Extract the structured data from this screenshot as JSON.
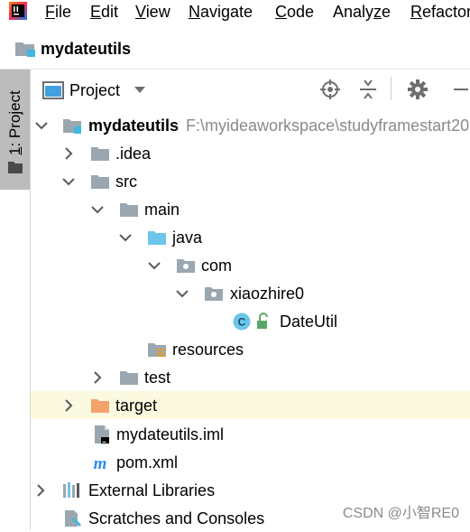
{
  "menu": {
    "items": [
      {
        "mnemonic": "F",
        "rest": "ile"
      },
      {
        "mnemonic": "E",
        "rest": "dit"
      },
      {
        "mnemonic": "V",
        "rest": "iew"
      },
      {
        "mnemonic": "N",
        "rest": "avigate"
      },
      {
        "mnemonic": "C",
        "rest": "ode"
      },
      {
        "pre": "Analy",
        "mnemonic": "z",
        "rest": "e"
      },
      {
        "mnemonic": "R",
        "rest": "efactor"
      }
    ]
  },
  "navbar": {
    "title": "mydateutils"
  },
  "toolwindow": {
    "tab_number": "1",
    "tab_rest": ": Project"
  },
  "panel": {
    "view_label": "Project"
  },
  "tree": {
    "root_name": "mydateutils",
    "root_path": "F:\\myideaworkspace\\studyframestart20",
    "idea": ".idea",
    "src": "src",
    "main": "main",
    "java": "java",
    "com": "com",
    "xiaozhire0": "xiaozhire0",
    "dateutil": "DateUtil",
    "resources": "resources",
    "test": "test",
    "target": "target",
    "iml": "mydateutils.iml",
    "pom": "pom.xml",
    "external_libraries": "External Libraries",
    "scratches": "Scratches and Consoles"
  },
  "watermark": "CSDN @小智RE0",
  "colors": {
    "selected_row": "#fbf9e0",
    "folder": "#9aa7b0",
    "source_folder": "#6cc6ea",
    "excluded_folder": "#f2a36b",
    "class_badge": "#6cc6ea",
    "maven_blue": "#2d8cf0"
  }
}
